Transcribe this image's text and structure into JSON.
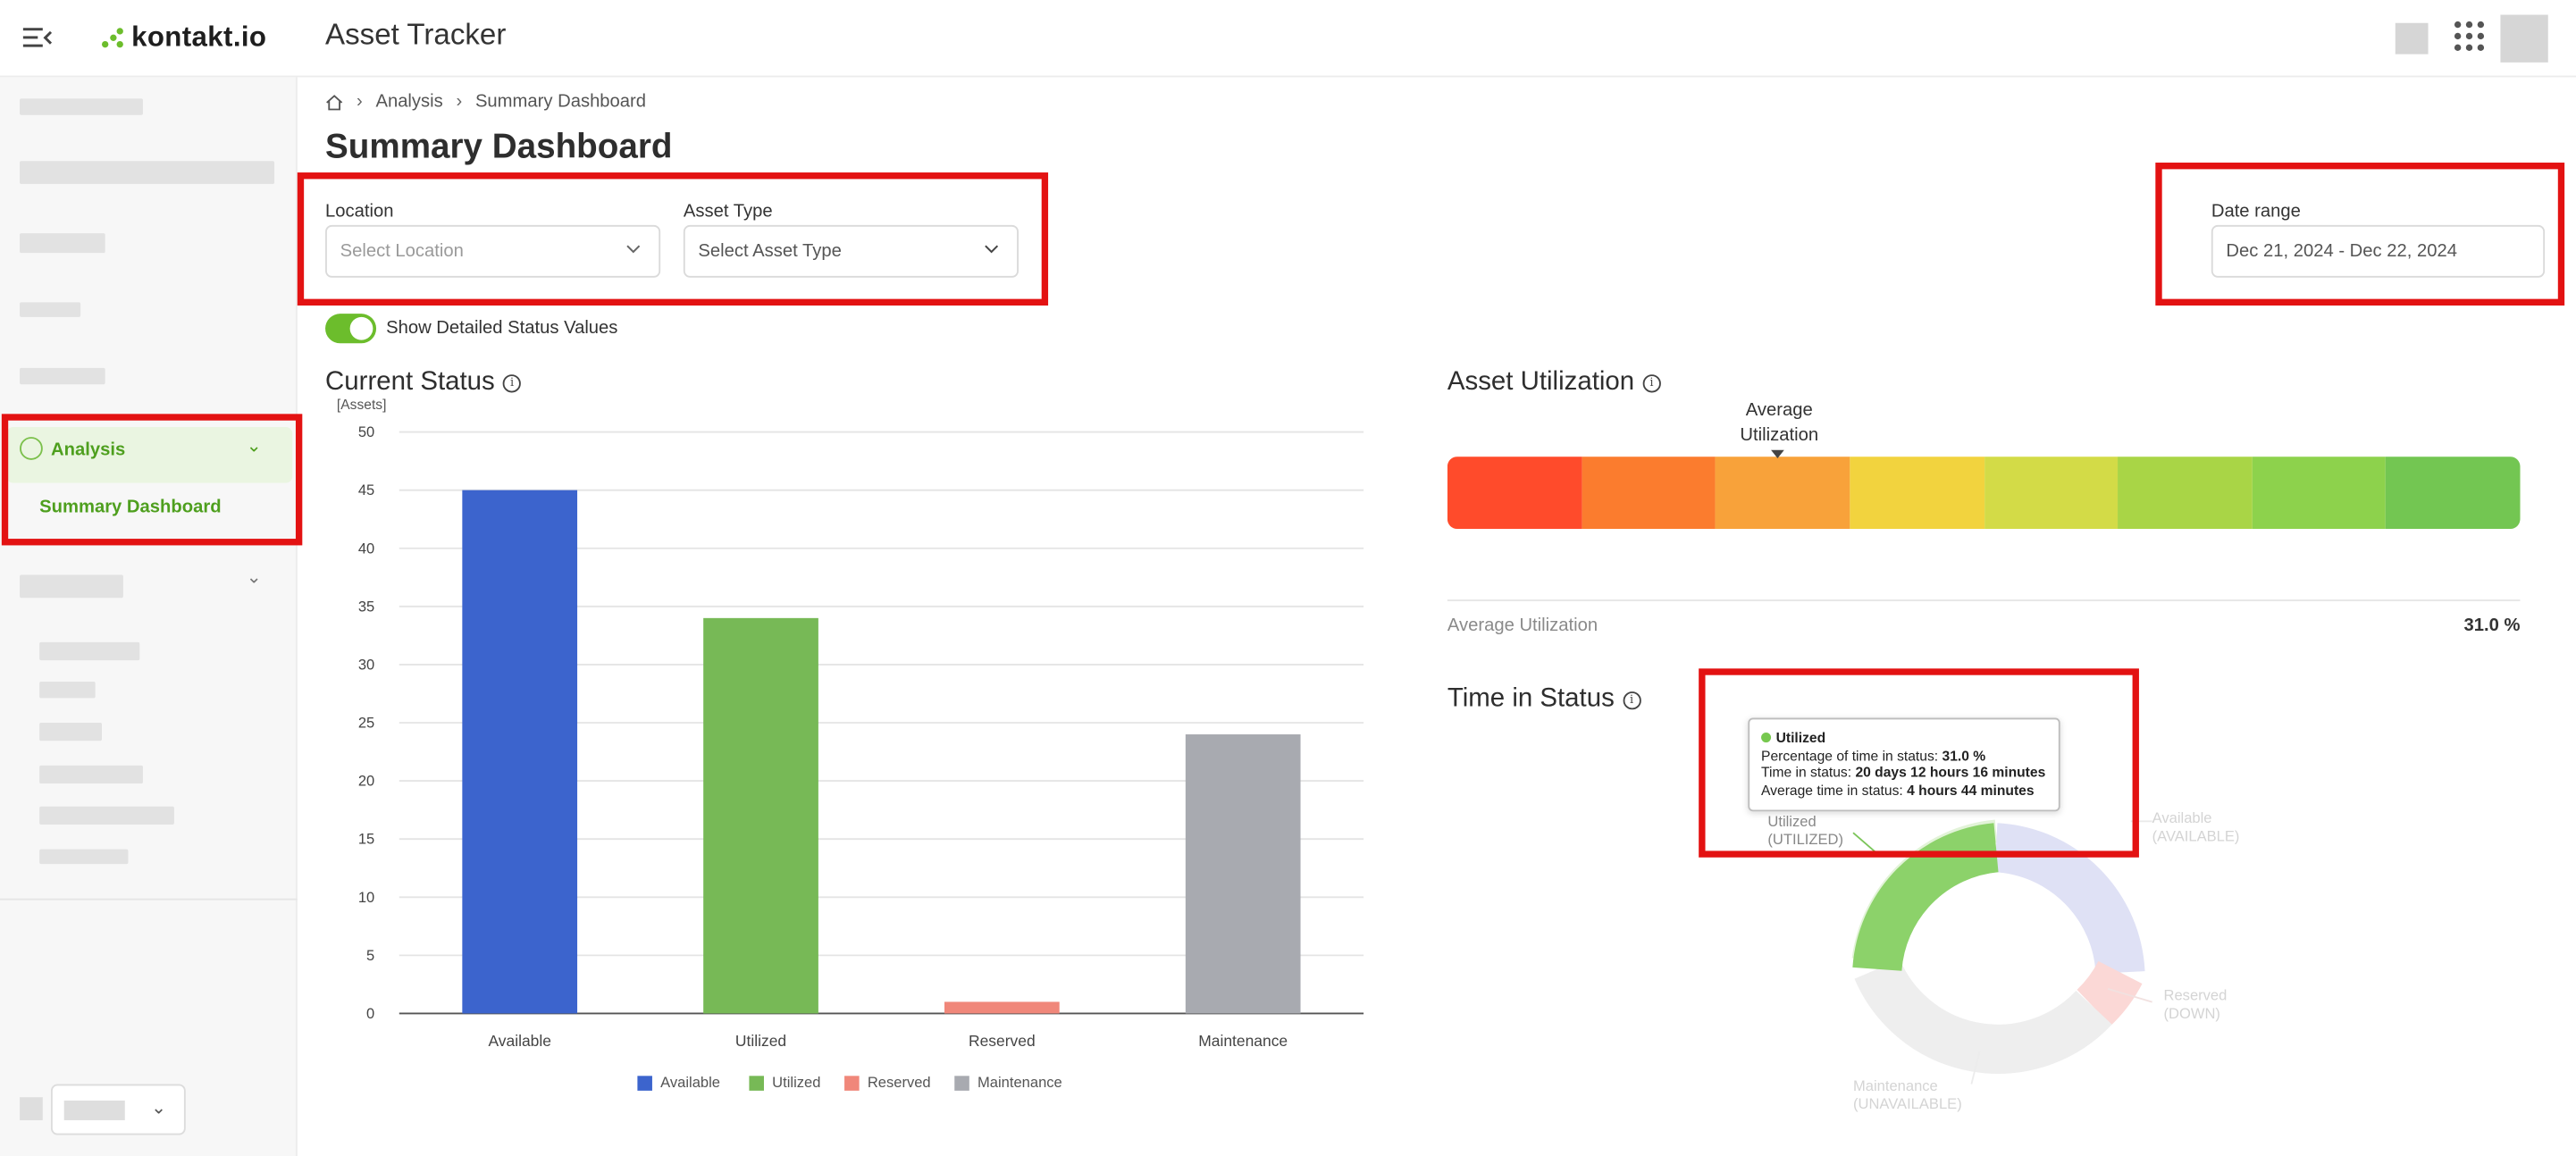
{
  "app": {
    "logo_text": "kontakt.io",
    "title": "Asset Tracker"
  },
  "sidebar": {
    "active_section": "Analysis",
    "active_item": "Summary Dashboard"
  },
  "breadcrumb": {
    "items": [
      "Analysis",
      "Summary Dashboard"
    ]
  },
  "page": {
    "title": "Summary Dashboard"
  },
  "filters": {
    "location": {
      "label": "Location",
      "placeholder": "Select Location"
    },
    "asset_type": {
      "label": "Asset Type",
      "placeholder": "Select Asset Type"
    },
    "date_range": {
      "label": "Date range",
      "value": "Dec 21, 2024 - Dec 22, 2024"
    }
  },
  "toggle": {
    "label": "Show Detailed Status Values",
    "on": true
  },
  "current_status": {
    "title": "Current Status",
    "legend": [
      "Available",
      "Utilized",
      "Reserved",
      "Maintenance"
    ]
  },
  "chart_data": {
    "type": "bar",
    "title": "Current Status",
    "ylabel": "[Assets]",
    "xlabel": "",
    "categories": [
      "Available",
      "Utilized",
      "Reserved",
      "Maintenance"
    ],
    "values": [
      45,
      34,
      1,
      24
    ],
    "colors": [
      "#3c64cd",
      "#77b956",
      "#f0877a",
      "#a8aab0"
    ],
    "ylim": [
      0,
      50
    ],
    "yticks": [
      0,
      5,
      10,
      15,
      20,
      25,
      30,
      35,
      40,
      45,
      50
    ],
    "grid": true,
    "legend": "bottom"
  },
  "asset_utilization": {
    "title": "Asset Utilization",
    "marker_label": "Average Utilization",
    "average_label": "Average Utilization",
    "average_value": "31.0 %",
    "scale_colors": [
      "#ff4b2b",
      "#fb7c2e",
      "#f8a23a",
      "#f2d33e",
      "#d3db47",
      "#a9d546",
      "#8dd24c",
      "#73c652"
    ]
  },
  "time_in_status": {
    "title": "Time in Status",
    "tooltip": {
      "title": "Utilized",
      "pct_label": "Percentage of time in status:",
      "pct_value": "31.0 %",
      "time_label": "Time in status:",
      "time_value": "20 days 12 hours 16 minutes",
      "avg_label": "Average time in status:",
      "avg_value": "4 hours 44 minutes"
    },
    "segments": [
      {
        "label": "Utilized",
        "sublabel": "(UTILIZED)",
        "color": "#8cd26a"
      },
      {
        "label": "Available",
        "sublabel": "(AVAILABLE)",
        "color": "#dfe1f5"
      },
      {
        "label": "Reserved",
        "sublabel": "(DOWN)",
        "color": "#fbd8d6"
      },
      {
        "label": "Maintenance",
        "sublabel": "(UNAVAILABLE)",
        "color": "#eeeeee"
      }
    ]
  }
}
